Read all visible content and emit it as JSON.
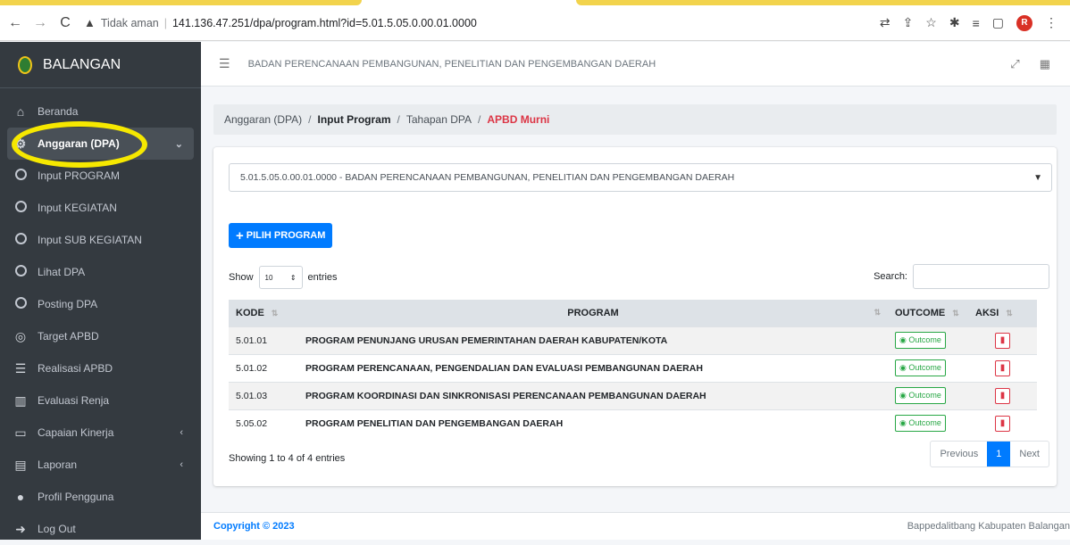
{
  "browser": {
    "security_label": "Tidak aman",
    "url": "141.136.47.251/dpa/program.html?id=5.01.5.05.0.00.01.0000",
    "avatar_letter": "R"
  },
  "sidebar": {
    "brand": "BALANGAN",
    "items": [
      {
        "label": "Beranda"
      },
      {
        "label": "Anggaran (DPA)"
      },
      {
        "label": "Input PROGRAM"
      },
      {
        "label": "Input KEGIATAN"
      },
      {
        "label": "Input SUB KEGIATAN"
      },
      {
        "label": "Lihat DPA"
      },
      {
        "label": "Posting DPA"
      },
      {
        "label": "Target APBD"
      },
      {
        "label": "Realisasi APBD"
      },
      {
        "label": "Evaluasi Renja"
      },
      {
        "label": "Capaian Kinerja"
      },
      {
        "label": "Laporan"
      },
      {
        "label": "Profil Pengguna"
      },
      {
        "label": "Log Out"
      }
    ]
  },
  "header": {
    "org_title": "BADAN PERENCANAAN PEMBANGUNAN, PENELITIAN DAN PENGEMBANGAN DAERAH"
  },
  "breadcrumb": {
    "items": [
      "Anggaran (DPA)",
      "Input Program",
      "Tahapan DPA",
      "APBD Murni"
    ],
    "sep": "/"
  },
  "form": {
    "select_value": "5.01.5.05.0.00.01.0000 - BADAN PERENCANAAN PEMBANGUNAN, PENELITIAN DAN PENGEMBANGAN DAERAH",
    "add_button": "PILIH PROGRAM"
  },
  "table": {
    "show_label": "Show",
    "entries_value": "10",
    "entries_label": "entries",
    "search_label": "Search:",
    "columns": [
      "KODE",
      "PROGRAM",
      "OUTCOME",
      "AKSI"
    ],
    "rows": [
      {
        "kode": "5.01.01",
        "program": "PROGRAM PENUNJANG URUSAN PEMERINTAHAN DAERAH KABUPATEN/KOTA",
        "outcome": "Outcome"
      },
      {
        "kode": "5.01.02",
        "program": "PROGRAM PERENCANAAN, PENGENDALIAN DAN EVALUASI PEMBANGUNAN DAERAH",
        "outcome": "Outcome"
      },
      {
        "kode": "5.01.03",
        "program": "PROGRAM KOORDINASI DAN SINKRONISASI PERENCANAAN PEMBANGUNAN DAERAH",
        "outcome": "Outcome"
      },
      {
        "kode": "5.05.02",
        "program": "PROGRAM PENELITIAN DAN PENGEMBANGAN DAERAH",
        "outcome": "Outcome"
      }
    ],
    "info": "Showing 1 to 4 of 4 entries",
    "pager": {
      "prev": "Previous",
      "page": "1",
      "next": "Next"
    }
  },
  "footer": {
    "copyright": "Copyright © 2023",
    "org": "Bappedalitbang Kabupaten Balangan"
  }
}
